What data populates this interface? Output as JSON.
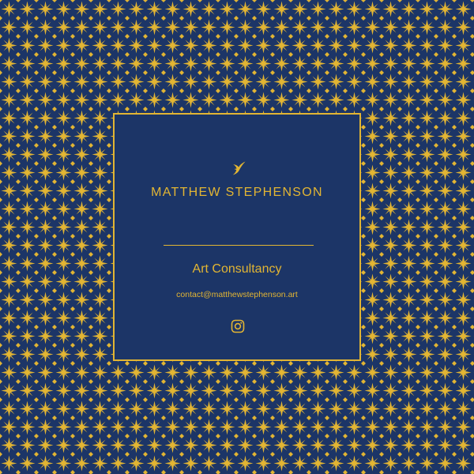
{
  "colors": {
    "background": "#1c3567",
    "accent": "#e2b533"
  },
  "card": {
    "logo_icon": "swallow-bird-icon",
    "name": "MATTHEW STEPHENSON",
    "tagline": "Art Consultancy",
    "email": "contact@matthewstephenson.art",
    "social_icon": "instagram-icon"
  }
}
